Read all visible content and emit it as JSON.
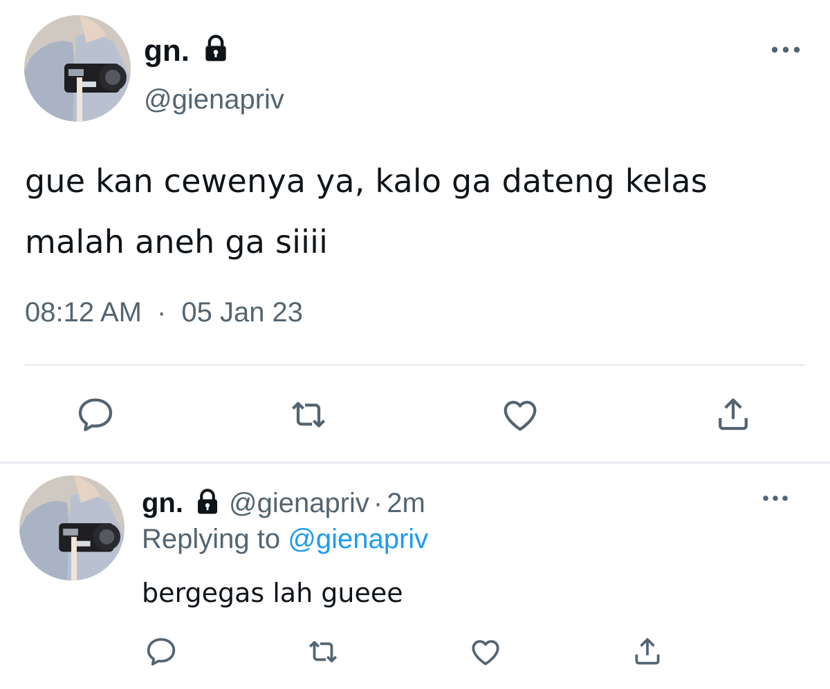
{
  "tweet": {
    "display_name": "gn.",
    "handle": "@gienapriv",
    "text": "gue kan cewenya ya, kalo ga dateng kelas malah aneh ga siiii",
    "time": "08:12 AM",
    "separator": "·",
    "date": "05 Jan 23",
    "actions": [
      "reply-icon",
      "retweet-icon",
      "like-icon",
      "share-icon"
    ],
    "more_icon": "more-icon",
    "lock_icon": "lock-icon"
  },
  "reply": {
    "display_name": "gn.",
    "handle": "@gienapriv",
    "separator": "·",
    "time": "2m",
    "replying_prefix": "Replying to",
    "replying_to": "@gienapriv",
    "text": "bergegas lah gueee",
    "actions": [
      "reply-icon",
      "retweet-icon",
      "like-icon",
      "share-icon"
    ]
  },
  "colors": {
    "text_primary": "#0f1419",
    "text_secondary": "#536471",
    "link": "#1d9bf0",
    "divider": "#e4e9ec"
  }
}
